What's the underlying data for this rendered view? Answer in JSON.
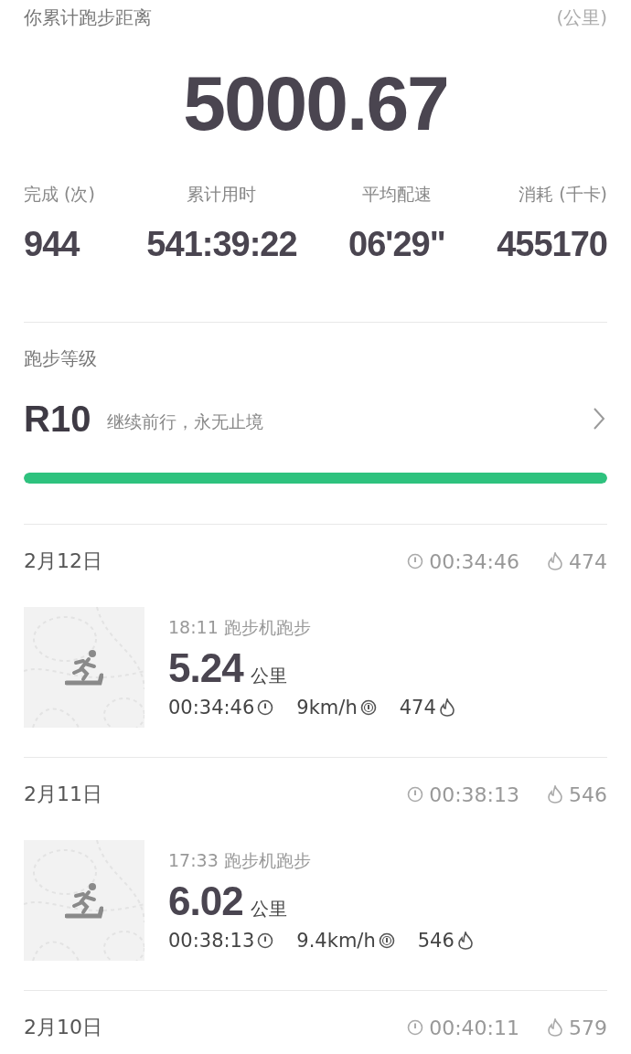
{
  "summary": {
    "title": "你累计跑步距离",
    "unit": "(公里)",
    "total": "5000.67"
  },
  "stats": [
    {
      "label": "完成 (次)",
      "value": "944"
    },
    {
      "label": "累计用时",
      "value": "541:39:22"
    },
    {
      "label": "平均配速",
      "value": "06'29\""
    },
    {
      "label": "消耗 (千卡)",
      "value": "455170"
    }
  ],
  "level": {
    "title": "跑步等级",
    "grade": "R10",
    "motto": "继续前行，永无止境",
    "level": 1
  },
  "days": [
    {
      "date": "2月12日",
      "duration": "00:34:46",
      "calories": "474",
      "runs": [
        {
          "time_type": "18:11 跑步机跑步",
          "distance": "5.24",
          "unit": "公里",
          "duration": "00:34:46",
          "speed": "9km/h",
          "calories": "474"
        }
      ]
    },
    {
      "date": "2月11日",
      "duration": "00:38:13",
      "calories": "546",
      "runs": [
        {
          "time_type": "17:33 跑步机跑步",
          "distance": "6.02",
          "unit": "公里",
          "duration": "00:38:13",
          "speed": "9.4km/h",
          "calories": "546"
        }
      ]
    },
    {
      "date": "2月10日",
      "duration": "00:40:11",
      "calories": "579"
    }
  ]
}
